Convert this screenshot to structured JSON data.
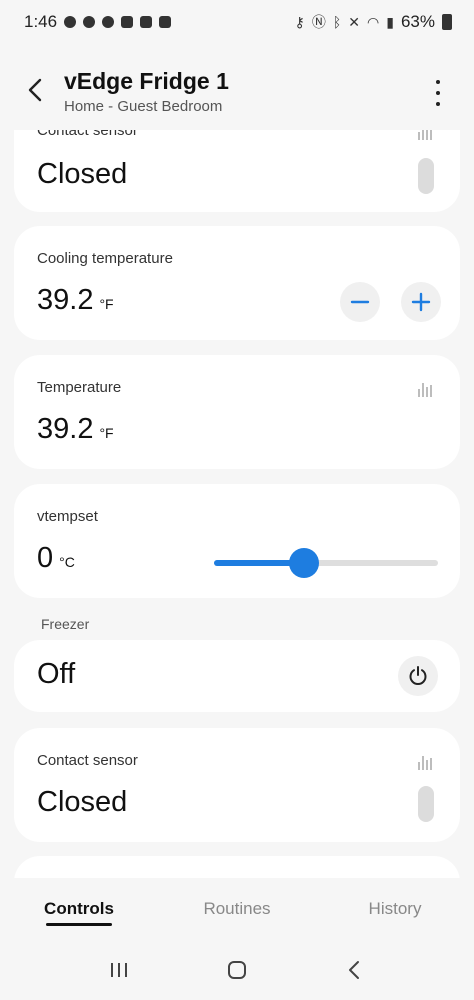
{
  "status_bar": {
    "time": "1:46",
    "battery": "63%"
  },
  "header": {
    "title": "vEdge Fridge 1",
    "subtitle": "Home - Guest Bedroom"
  },
  "cards": {
    "contact_top": {
      "label": "Contact sensor",
      "value": "Closed"
    },
    "cooling": {
      "label": "Cooling temperature",
      "value": "39.2",
      "unit": "°F"
    },
    "temperature": {
      "label": "Temperature",
      "value": "39.2",
      "unit": "°F"
    },
    "vtempset": {
      "label": "vtempset",
      "value": "0",
      "unit": "°C",
      "slider_fraction": 0.4
    },
    "freezer": {
      "section_label": "Freezer",
      "value": "Off"
    },
    "contact_bottom": {
      "label": "Contact sensor",
      "value": "Closed"
    }
  },
  "tabs": [
    {
      "label": "Controls",
      "active": true
    },
    {
      "label": "Routines",
      "active": false
    },
    {
      "label": "History",
      "active": false
    }
  ],
  "colors": {
    "accent": "#1e7de0",
    "background": "#f6f6f6",
    "card": "#ffffff"
  }
}
